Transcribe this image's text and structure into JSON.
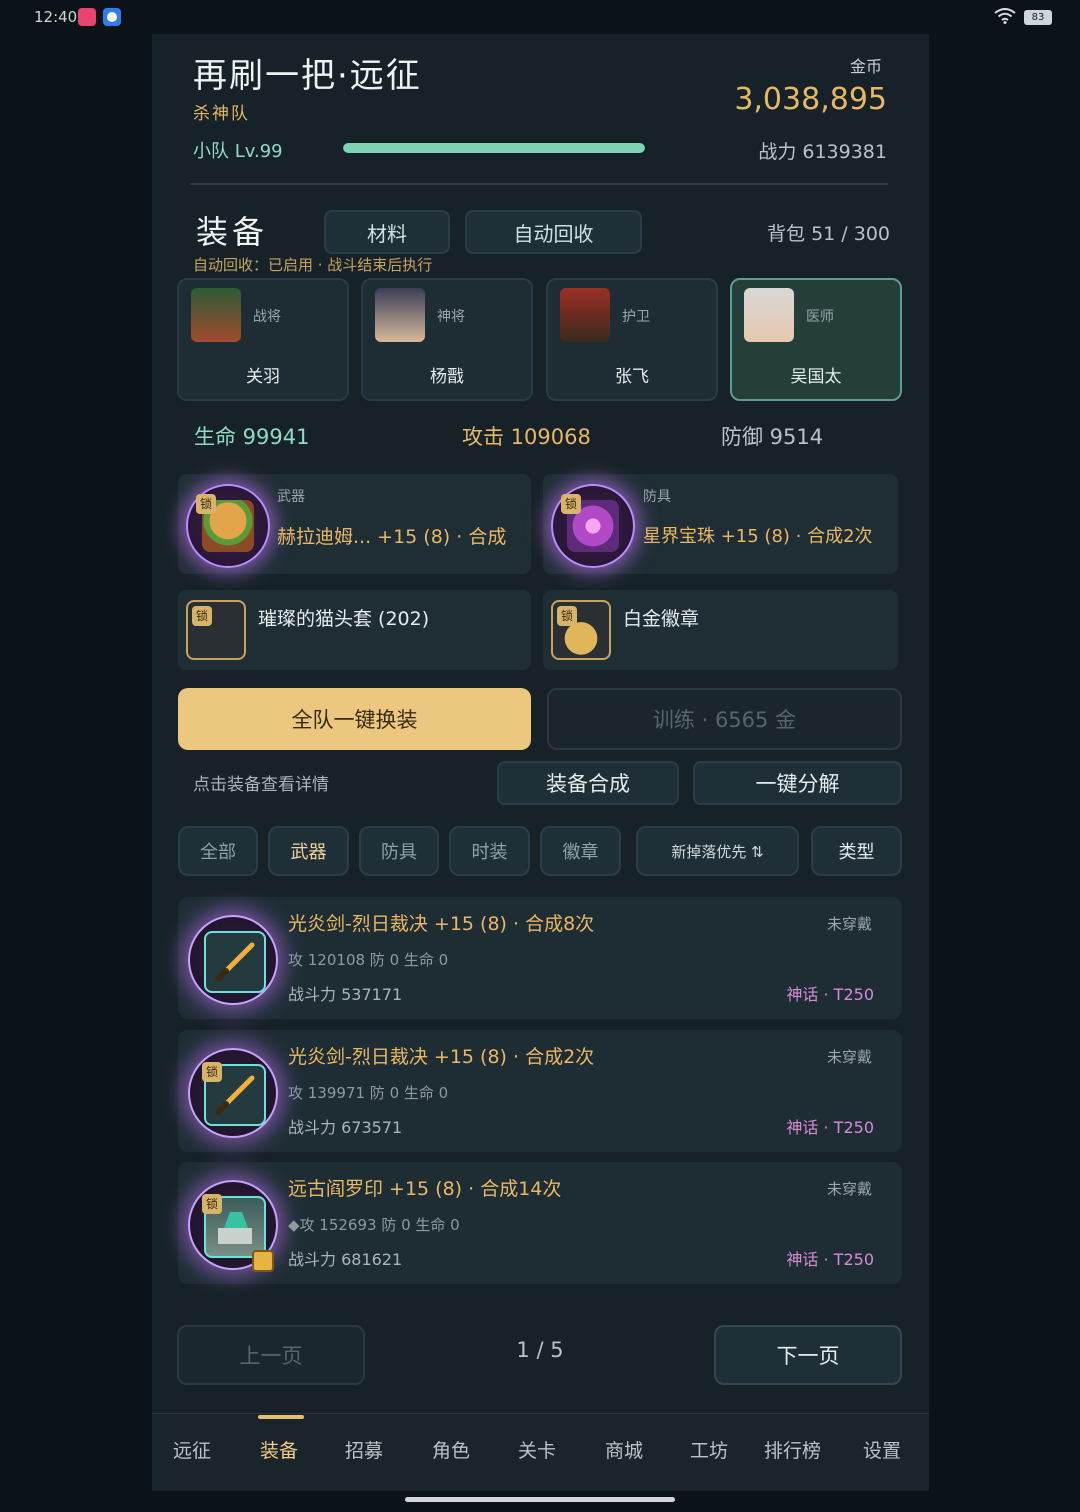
{
  "status_bar": {
    "time": "12:40",
    "battery": "83"
  },
  "header": {
    "title": "再刷一把·远征",
    "team_name": "杀神队",
    "team_level": "小队 Lv.99",
    "exp_fraction": 1.0,
    "gold_label": "金币",
    "gold_value": "3,038,895",
    "power_total": "战力 6139381"
  },
  "equipment_section": {
    "title": "装备",
    "tab_materials": "材料",
    "tab_auto_recycle": "自动回收",
    "bag_capacity": "背包 51 / 300",
    "recycle_note": "自动回收：已启用 · 战斗结束后执行"
  },
  "heroes": [
    {
      "role": "战将",
      "name": "关羽",
      "selected": false
    },
    {
      "role": "神将",
      "name": "杨戬",
      "selected": false
    },
    {
      "role": "护卫",
      "name": "张飞",
      "selected": false
    },
    {
      "role": "医师",
      "name": "吴国太",
      "selected": true
    }
  ],
  "hero_stats": {
    "hp": "生命 99941",
    "atk": "攻击 109068",
    "def": "防御 9514"
  },
  "equipped": {
    "weapon": {
      "type": "武器",
      "name": "赫拉迪姆... +15 (8) · 合成",
      "lock": "锁"
    },
    "armor": {
      "type": "防具",
      "name": "星界宝珠 +15 (8) · 合成2次",
      "lock": "锁"
    },
    "fashion": {
      "name": "璀璨的猫头套 (202)",
      "lock": "锁"
    },
    "badge": {
      "name": "白金徽章",
      "lock": "锁"
    }
  },
  "actions": {
    "team_equip": "全队一键换装",
    "train": "训练 · 6565 金",
    "hint": "点击装备查看详情",
    "synthesize": "装备合成",
    "decompose": "一键分解"
  },
  "filters": [
    "全部",
    "武器",
    "防具",
    "时装",
    "徽章",
    "新掉落优先 ⇅",
    "类型"
  ],
  "items": [
    {
      "name": "光炎剑-烈日裁决 +15 (8) · 合成8次",
      "equip_status": "未穿戴",
      "stats": "攻 120108  防 0  生命 0",
      "power": "战斗力 537171",
      "tier": "神话 · T250",
      "locked": false,
      "lock": ""
    },
    {
      "name": "光炎剑-烈日裁决 +15 (8) · 合成2次",
      "equip_status": "未穿戴",
      "stats": "攻 139971  防 0  生命 0",
      "power": "战斗力 673571",
      "tier": "神话 · T250",
      "locked": true,
      "lock": "锁"
    },
    {
      "name": "远古阎罗印 +15 (8) · 合成14次",
      "equip_status": "未穿戴",
      "stats": "◆攻 152693  防 0  生命 0",
      "power": "战斗力 681621",
      "tier": "神话 · T250",
      "locked": true,
      "lock": "锁"
    }
  ],
  "pagination": {
    "prev": "上一页",
    "indicator": "1 / 5",
    "next": "下一页"
  },
  "bottom_nav": [
    "远征",
    "装备",
    "招募",
    "角色",
    "关卡",
    "商城",
    "工坊",
    "排行榜",
    "设置"
  ],
  "colors": {
    "accent_gold": "#ecc77f",
    "exp_green": "#7dd3b4",
    "epic_purple": "#c7a2ff",
    "mythic_pink": "#d78ad6"
  }
}
